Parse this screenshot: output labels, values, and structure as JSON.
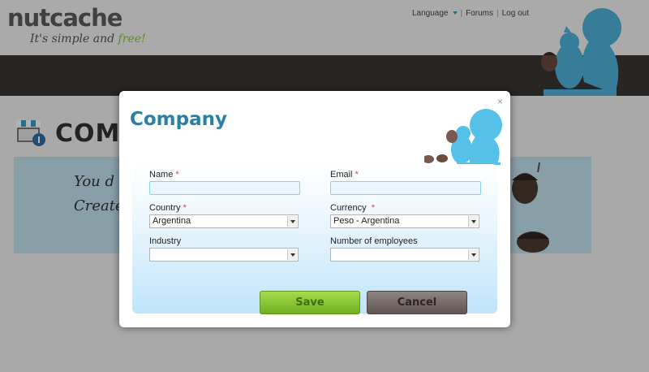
{
  "header": {
    "logo_text": "nutcache",
    "tagline_main": "It's simple and ",
    "tagline_accent": "free!",
    "nav": {
      "language": "Language",
      "forums": "Forums",
      "logout": "Log out",
      "separator": "|"
    }
  },
  "page": {
    "title": "COMPA",
    "info_line_1": "You d",
    "info_line_2": "Create"
  },
  "modal": {
    "title": "Company",
    "close_glyph": "×",
    "fields": {
      "name_label": "Name",
      "email_label": "Email",
      "country_label": "Country",
      "country_value": "Argentina",
      "currency_label": "Currency",
      "currency_value": "Peso - Argentina",
      "industry_label": "Industry",
      "industry_value": "",
      "employees_label": "Number of employees",
      "employees_value": "",
      "required_mark": "*"
    },
    "buttons": {
      "save": "Save",
      "cancel": "Cancel"
    }
  },
  "icons": [
    "squirrel-icon",
    "store-info-icon",
    "acorn-icon",
    "close-icon",
    "chevron-down-icon"
  ],
  "colors": {
    "accent_blue": "#2a7fa6",
    "squirrel_blue": "#55c0e8",
    "save_green": "#8cc63f",
    "cancel_gray": "#6b6260",
    "required_red": "#e0433a"
  }
}
